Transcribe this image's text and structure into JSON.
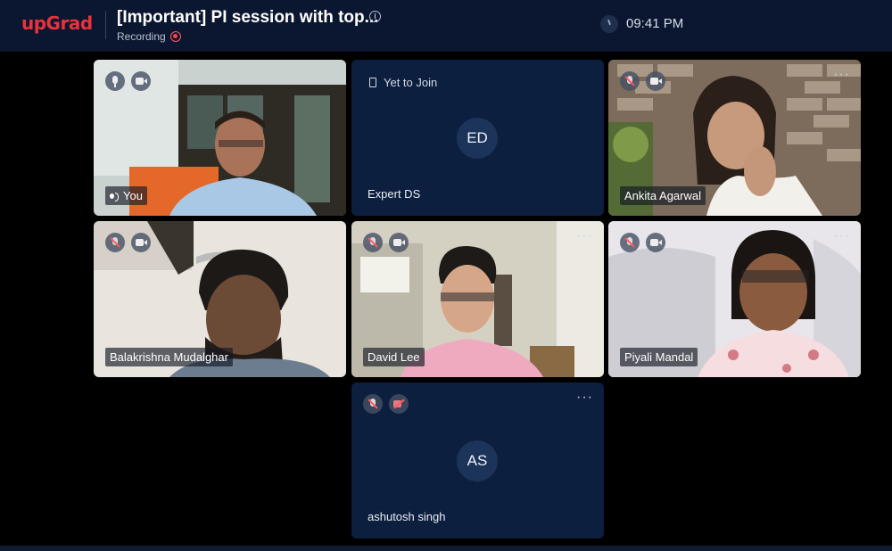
{
  "header": {
    "logo": "upGrad",
    "title": "[Important] PI session with top...",
    "recording_label": "Recording",
    "time": "09:41 PM"
  },
  "colors": {
    "topbar": "#0b1730",
    "logo": "#e8323c",
    "tile_bg": "#0d1f3f",
    "recording": "#ff3d48"
  },
  "participants": [
    {
      "name": "You",
      "mic": "on",
      "camera": "on",
      "video": true
    },
    {
      "name": "Expert DS",
      "status": "Yet to Join",
      "initials": "ED",
      "video": false
    },
    {
      "name": "Ankita Agarwal",
      "mic": "off",
      "camera": "on",
      "video": true
    },
    {
      "name": "Balakrishna Mudalghar",
      "mic": "off",
      "camera": "on",
      "video": true
    },
    {
      "name": "David Lee",
      "mic": "off",
      "camera": "on",
      "video": true
    },
    {
      "name": "Piyali Mandal",
      "mic": "off",
      "camera": "on",
      "video": true
    },
    {
      "name": "ashutosh singh",
      "initials": "AS",
      "mic": "off",
      "camera": "off",
      "video": false
    }
  ],
  "icons": {
    "more": "more-options-icon",
    "info": "info-icon",
    "clock": "clock-icon"
  }
}
